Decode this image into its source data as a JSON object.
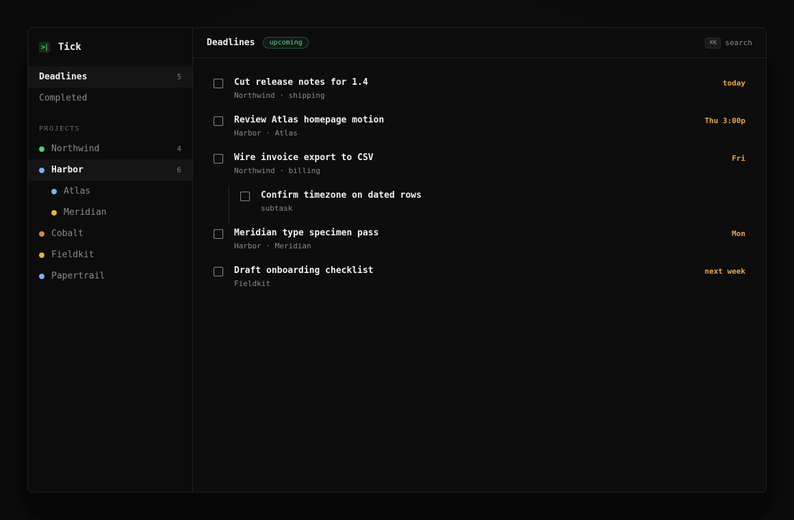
{
  "app": {
    "name": "Tick",
    "logo_glyph": ">|",
    "accent": "#52d17a"
  },
  "sidebar": {
    "nav": [
      {
        "label": "Deadlines",
        "count": "5",
        "active": true
      },
      {
        "label": "Completed",
        "count": "",
        "active": false
      }
    ],
    "section_label": "PROJECTS",
    "projects": [
      {
        "label": "Northwind",
        "count": "4",
        "color": "#4fcf6a",
        "child": false,
        "active": false
      },
      {
        "label": "Harbor",
        "count": "6",
        "color": "#7fb0ef",
        "child": false,
        "active": true
      },
      {
        "label": "Atlas",
        "count": "",
        "color": "#7fb0ef",
        "child": true,
        "active": false
      },
      {
        "label": "Meridian",
        "count": "",
        "color": "#e6b43c",
        "child": true,
        "active": false
      },
      {
        "label": "Cobalt",
        "count": "",
        "color": "#d9824a",
        "child": false,
        "active": false
      },
      {
        "label": "Fieldkit",
        "count": "",
        "color": "#e6b43c",
        "child": false,
        "active": false
      },
      {
        "label": "Papertrail",
        "count": "",
        "color": "#7fb0ef",
        "child": false,
        "active": false
      }
    ]
  },
  "header": {
    "title": "Deadlines",
    "badge": "upcoming",
    "shortcut": "⌘K",
    "search_label": "search"
  },
  "tasks": [
    {
      "title": "Cut release notes for 1.4",
      "meta": "Northwind · shipping",
      "date": "today",
      "subtask": false
    },
    {
      "title": "Review Atlas homepage motion",
      "meta": "Harbor · Atlas",
      "date": "Thu 3:00p",
      "subtask": false
    },
    {
      "title": "Wire invoice export to CSV",
      "meta": "Northwind · billing",
      "date": "Fri",
      "subtask": false
    },
    {
      "title": "Confirm timezone on dated rows",
      "meta": "subtask",
      "date": "",
      "subtask": true
    },
    {
      "title": "Meridian type specimen pass",
      "meta": "Harbor · Meridian",
      "date": "Mon",
      "subtask": false
    },
    {
      "title": "Draft onboarding checklist",
      "meta": "Fieldkit",
      "date": "next week",
      "subtask": false
    }
  ]
}
